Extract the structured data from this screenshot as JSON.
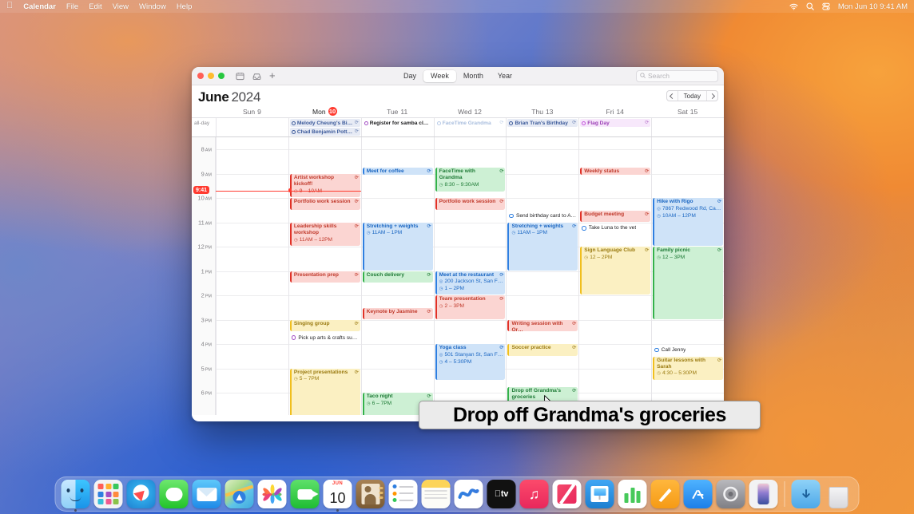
{
  "menubar": {
    "apple": "apple-logo",
    "items": [
      "Calendar",
      "File",
      "Edit",
      "View",
      "Window",
      "Help"
    ],
    "status_icons": [
      "wifi-icon",
      "spotlight-search-icon",
      "control-center-icon"
    ],
    "clock": "Mon Jun 10  9:41 AM"
  },
  "window": {
    "toolbar": {
      "traffic_lights": [
        "close-button",
        "minimize-button",
        "zoom-button"
      ],
      "calendar_list_icon": "calendar-sidebar-icon",
      "inbox_icon": "inbox-icon",
      "add_label": "+",
      "views": [
        {
          "label": "Day",
          "active": false
        },
        {
          "label": "Week",
          "active": true
        },
        {
          "label": "Month",
          "active": false
        },
        {
          "label": "Year",
          "active": false
        }
      ],
      "search_placeholder": "Search"
    },
    "header": {
      "month": "June",
      "year": "2024",
      "prev_label": "‹",
      "today_label": "Today",
      "next_label": "›"
    },
    "allday_label": "all-day",
    "days": [
      {
        "name": "Sun",
        "num": "9",
        "today": false
      },
      {
        "name": "Mon",
        "num": "10",
        "today": true
      },
      {
        "name": "Tue",
        "num": "11",
        "today": false
      },
      {
        "name": "Wed",
        "num": "12",
        "today": false
      },
      {
        "name": "Thu",
        "num": "13",
        "today": false
      },
      {
        "name": "Fri",
        "num": "14",
        "today": false
      },
      {
        "name": "Sat",
        "num": "15",
        "today": false
      }
    ],
    "hours": [
      {
        "label": "8",
        "ap": "AM"
      },
      {
        "label": "9",
        "ap": "AM"
      },
      {
        "label": "10",
        "ap": "AM"
      },
      {
        "label": "11",
        "ap": "AM"
      },
      {
        "label": "12",
        "ap": "PM"
      },
      {
        "label": "1",
        "ap": "PM"
      },
      {
        "label": "2",
        "ap": "PM"
      },
      {
        "label": "3",
        "ap": "PM"
      },
      {
        "label": "4",
        "ap": "PM"
      },
      {
        "label": "5",
        "ap": "PM"
      },
      {
        "label": "6",
        "ap": "PM"
      }
    ],
    "now": {
      "time": "9:41",
      "day_index": 1
    },
    "allday_events": [
      {
        "day": 1,
        "title": "Melody Cheung's Birt…",
        "kind": "birthday",
        "repeat": true,
        "color": "#3c5a9a",
        "bg": "#e7ebf5"
      },
      {
        "day": 1,
        "title": "Chad Benjamin Potter…",
        "kind": "birthday",
        "repeat": true,
        "color": "#3c5a9a",
        "bg": "#e7ebf5"
      },
      {
        "day": 2,
        "title": "Register for samba class",
        "kind": "reminder",
        "repeat": false,
        "color": "#1d1d1f",
        "bg": "#ffffff"
      },
      {
        "day": 3,
        "title": "FaceTime Grandma",
        "kind": "dimmed",
        "repeat": true,
        "color": "#a9bede",
        "bg": "#ffffff"
      },
      {
        "day": 4,
        "title": "Brian Tran's Birthday",
        "kind": "birthday",
        "repeat": true,
        "color": "#3c5a9a",
        "bg": "#e7ebf5"
      },
      {
        "day": 5,
        "title": "Flag Day",
        "kind": "holiday",
        "repeat": true,
        "color": "#9b3fb5",
        "bg": "#f7e8fb"
      }
    ],
    "events": [
      {
        "day": 2,
        "title": "Meet for coffee",
        "time": "",
        "loc": "",
        "start": 8.75,
        "end": 9.0,
        "color": "#1a66c2",
        "bg": "#cfe3f8",
        "bar": "#2f7fe0",
        "repeat": true
      },
      {
        "day": 3,
        "title": "FaceTime with Grandma",
        "time": "8:30 – 9:30AM",
        "loc": "",
        "start": 8.75,
        "end": 9.75,
        "color": "#1d7a35",
        "bg": "#cdf0d4",
        "bar": "#34b14b",
        "repeat": true
      },
      {
        "day": 5,
        "title": "Weekly status",
        "time": "",
        "loc": "",
        "start": 8.75,
        "end": 9.0,
        "color": "#c0392b",
        "bg": "#fbd5d2",
        "bar": "#e03127",
        "repeat": true
      },
      {
        "day": 1,
        "title": "Artist workshop kickoff!",
        "time": "9 – 10AM",
        "loc": "",
        "start": 9.0,
        "end": 10.0,
        "color": "#c0392b",
        "bg": "#fbd5d2",
        "bar": "#e03127",
        "repeat": true
      },
      {
        "day": 1,
        "title": "Portfolio work session",
        "time": "",
        "loc": "",
        "start": 10.0,
        "end": 10.5,
        "color": "#c0392b",
        "bg": "#fbd5d2",
        "bar": "#e03127",
        "repeat": true
      },
      {
        "day": 3,
        "title": "Portfolio work session",
        "time": "",
        "loc": "",
        "start": 10.0,
        "end": 10.5,
        "color": "#c0392b",
        "bg": "#fbd5d2",
        "bar": "#e03127",
        "repeat": true
      },
      {
        "day": 6,
        "title": "Hike with Rigo",
        "time": "10AM – 12PM",
        "loc": "7867 Redwood Rd, Castr…",
        "start": 10.0,
        "end": 12.0,
        "color": "#1a66c2",
        "bg": "#cfe3f8",
        "bar": "#2f7fe0",
        "repeat": true
      },
      {
        "day": 5,
        "title": "Budget meeting",
        "time": "",
        "loc": "",
        "start": 10.5,
        "end": 11.0,
        "color": "#c0392b",
        "bg": "#fbd5d2",
        "bar": "#e03127",
        "repeat": true
      },
      {
        "day": 1,
        "title": "Leadership skills workshop",
        "time": "11AM – 12PM",
        "loc": "",
        "start": 11.0,
        "end": 12.0,
        "color": "#c0392b",
        "bg": "#fbd5d2",
        "bar": "#e03127",
        "repeat": true
      },
      {
        "day": 2,
        "title": "Stretching + weights",
        "time": "11AM – 1PM",
        "loc": "",
        "start": 11.0,
        "end": 13.0,
        "color": "#1a66c2",
        "bg": "#cfe3f8",
        "bar": "#2f7fe0",
        "repeat": true
      },
      {
        "day": 4,
        "title": "Stretching + weights",
        "time": "11AM – 1PM",
        "loc": "",
        "start": 11.0,
        "end": 13.0,
        "color": "#1a66c2",
        "bg": "#cfe3f8",
        "bar": "#2f7fe0",
        "repeat": true
      },
      {
        "day": 5,
        "title": "Sign Language Club",
        "time": "12 – 2PM",
        "loc": "",
        "start": 12.0,
        "end": 14.0,
        "color": "#9a7a10",
        "bg": "#fbf0c2",
        "bar": "#f0bf1e",
        "repeat": true
      },
      {
        "day": 6,
        "title": "Family picnic",
        "time": "12 – 3PM",
        "loc": "",
        "start": 12.0,
        "end": 15.0,
        "color": "#1d7a35",
        "bg": "#cdf0d4",
        "bar": "#34b14b",
        "repeat": true
      },
      {
        "day": 1,
        "title": "Presentation prep",
        "time": "",
        "loc": "",
        "start": 13.0,
        "end": 13.5,
        "color": "#c0392b",
        "bg": "#fbd5d2",
        "bar": "#e03127",
        "repeat": true
      },
      {
        "day": 2,
        "title": "Couch delivery",
        "time": "",
        "loc": "",
        "start": 13.0,
        "end": 13.5,
        "color": "#1d7a35",
        "bg": "#cdf0d4",
        "bar": "#34b14b",
        "repeat": true
      },
      {
        "day": 3,
        "title": "Meet at the restaurant",
        "time": "1 – 2PM",
        "loc": "200 Jackson St, San Fran…",
        "start": 13.0,
        "end": 14.0,
        "color": "#1a66c2",
        "bg": "#cfe3f8",
        "bar": "#2f7fe0",
        "repeat": true
      },
      {
        "day": 3,
        "title": "Team presentation",
        "time": "2 – 3PM",
        "loc": "",
        "start": 14.0,
        "end": 15.0,
        "color": "#c0392b",
        "bg": "#fbd5d2",
        "bar": "#e03127",
        "repeat": true
      },
      {
        "day": 2,
        "title": "Keynote by Jasmine",
        "time": "",
        "loc": "",
        "start": 14.5,
        "end": 15.0,
        "color": "#c0392b",
        "bg": "#fbd5d2",
        "bar": "#e03127",
        "repeat": true
      },
      {
        "day": 1,
        "title": "Singing group",
        "time": "",
        "loc": "",
        "start": 15.0,
        "end": 15.5,
        "color": "#9a7a10",
        "bg": "#fbf0c2",
        "bar": "#f0bf1e",
        "repeat": true
      },
      {
        "day": 4,
        "title": "Writing session with Or…",
        "time": "",
        "loc": "",
        "start": 15.0,
        "end": 15.5,
        "color": "#c0392b",
        "bg": "#fbd5d2",
        "bar": "#e03127",
        "repeat": true
      },
      {
        "day": 3,
        "title": "Yoga class",
        "time": "4 – 5:30PM",
        "loc": "501 Stanyan St, San Fran…",
        "start": 16.0,
        "end": 17.5,
        "color": "#1a66c2",
        "bg": "#cfe3f8",
        "bar": "#2f7fe0",
        "repeat": true
      },
      {
        "day": 4,
        "title": "Soccer practice",
        "time": "",
        "loc": "",
        "start": 16.0,
        "end": 16.5,
        "color": "#9a7a10",
        "bg": "#fbf0c2",
        "bar": "#f0bf1e",
        "repeat": true
      },
      {
        "day": 6,
        "title": "Guitar lessons with Sarah",
        "time": "4:30 – 5:30PM",
        "loc": "",
        "start": 16.5,
        "end": 17.5,
        "color": "#9a7a10",
        "bg": "#fbf0c2",
        "bar": "#f0bf1e",
        "repeat": true
      },
      {
        "day": 1,
        "title": "Project presentations",
        "time": "5 – 7PM",
        "loc": "",
        "start": 17.0,
        "end": 19.0,
        "color": "#9a7a10",
        "bg": "#fbf0c2",
        "bar": "#f0bf1e",
        "repeat": true
      },
      {
        "day": 4,
        "title": "Drop off Grandma's groceries",
        "time": "",
        "loc": "",
        "start": 17.75,
        "end": 18.5,
        "color": "#1d7a35",
        "bg": "#cdf0d4",
        "bar": "#34b14b",
        "repeat": true
      },
      {
        "day": 2,
        "title": "Taco night",
        "time": "6 – 7PM",
        "loc": "",
        "start": 18.0,
        "end": 19.0,
        "color": "#1d7a35",
        "bg": "#cdf0d4",
        "bar": "#34b14b",
        "repeat": true
      }
    ],
    "reminders": [
      {
        "day": 4,
        "title": "Send birthday card to A…",
        "start": 10.55,
        "color": "#2f7fe0"
      },
      {
        "day": 5,
        "title": "Take Luna to the vet",
        "start": 11.05,
        "color": "#2f7fe0"
      },
      {
        "day": 1,
        "title": "Pick up arts & crafts sup…",
        "start": 15.55,
        "color": "#a34fc4"
      },
      {
        "day": 6,
        "title": "Call Jenny",
        "start": 16.05,
        "color": "#2f7fe0"
      }
    ]
  },
  "caption": {
    "text": "Drop off Grandma's groceries"
  },
  "dock": {
    "items": [
      {
        "name": "finder",
        "label": "Finder"
      },
      {
        "name": "launchpad",
        "label": "Launchpad"
      },
      {
        "name": "safari",
        "label": "Safari"
      },
      {
        "name": "messages",
        "label": "Messages"
      },
      {
        "name": "mail",
        "label": "Mail"
      },
      {
        "name": "maps",
        "label": "Maps"
      },
      {
        "name": "photos",
        "label": "Photos"
      },
      {
        "name": "facetime",
        "label": "FaceTime"
      },
      {
        "name": "calendar",
        "label": "Calendar",
        "month": "JUN",
        "day": "10",
        "running": true
      },
      {
        "name": "contacts",
        "label": "Contacts"
      },
      {
        "name": "reminders",
        "label": "Reminders"
      },
      {
        "name": "notes",
        "label": "Notes"
      },
      {
        "name": "freeform",
        "label": "Freeform"
      },
      {
        "name": "appletv",
        "label": "Apple TV"
      },
      {
        "name": "music",
        "label": "Music"
      },
      {
        "name": "news",
        "label": "News"
      },
      {
        "name": "keynote",
        "label": "Keynote"
      },
      {
        "name": "numbers",
        "label": "Numbers"
      },
      {
        "name": "pages",
        "label": "Pages"
      },
      {
        "name": "appstore",
        "label": "App Store"
      },
      {
        "name": "settings",
        "label": "System Settings"
      },
      {
        "name": "iphone-mirroring",
        "label": "iPhone Mirroring"
      },
      {
        "name": "downloads-folder",
        "label": "Downloads"
      },
      {
        "name": "trash",
        "label": "Trash"
      }
    ]
  }
}
